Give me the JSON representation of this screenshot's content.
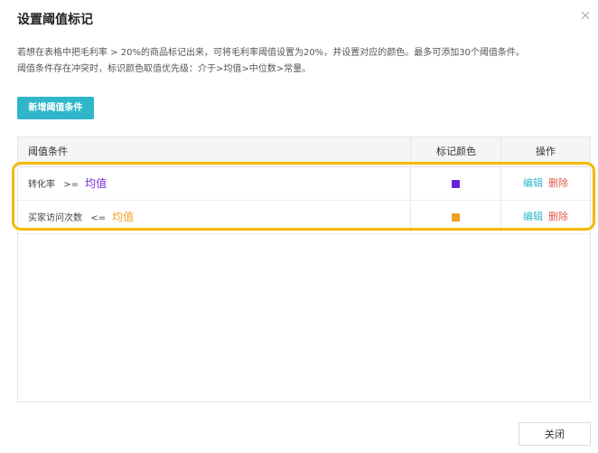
{
  "dialog": {
    "title": "设置阈值标记",
    "close_icon": "close-icon"
  },
  "description": {
    "line1": "若想在表格中把毛利率 > 20%的商品标记出来，可将毛利率阈值设置为20%，并设置对应的颜色。最多可添加30个阈值条件。",
    "line2": "阈值条件存在冲突时，标识颜色取值优先级：介于>均值>中位数>常量。"
  },
  "add_button": {
    "label": "新增阈值条件"
  },
  "table": {
    "headers": {
      "condition": "阈值条件",
      "color": "标记颜色",
      "actions": "操作"
    },
    "rows": [
      {
        "metric": "转化率",
        "operator": ">=",
        "value": "均值",
        "value_color": "#7a2bd9",
        "swatch_color": "#6a1fe0",
        "edit_label": "编辑",
        "delete_label": "删除"
      },
      {
        "metric": "买家访问次数",
        "operator": "<=",
        "value": "均值",
        "value_color": "#f0a020",
        "swatch_color": "#f0a020",
        "edit_label": "编辑",
        "delete_label": "删除"
      }
    ]
  },
  "footer": {
    "close_label": "关闭"
  },
  "colors": {
    "accent": "#2fb6cb",
    "highlight": "#f5b800",
    "delete": "#e05a4f"
  }
}
